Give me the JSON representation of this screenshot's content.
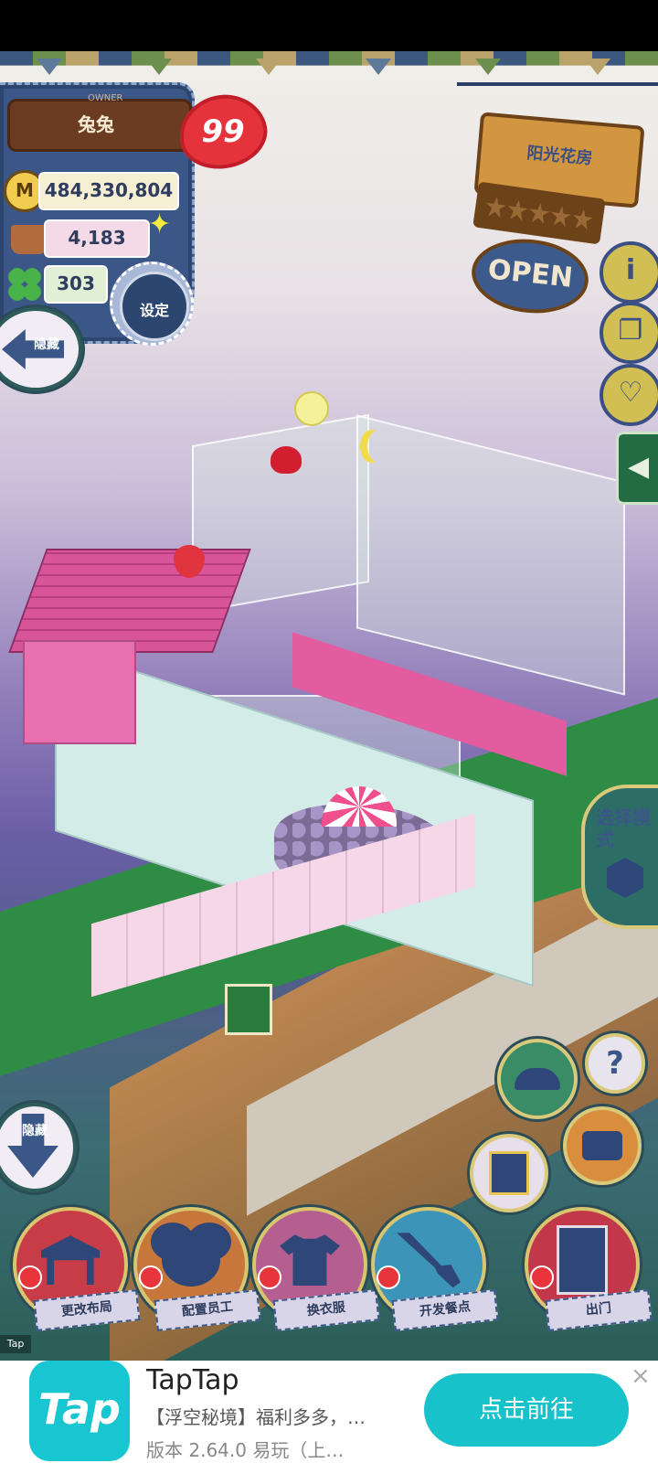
{
  "owner": {
    "label": "OWNER",
    "name": "兔兔",
    "level": "99"
  },
  "stats": {
    "money": "484,330,804",
    "money_icon_letter": "M",
    "customers": "4,183",
    "clovers": "303"
  },
  "buttons": {
    "settings": "设定",
    "hide_top": "隐藏",
    "hide_bottom": "隐藏",
    "select_mode": "选择模式",
    "help": "?"
  },
  "shop": {
    "name": "阳光花房",
    "rating_stars": 0,
    "max_stars": 5,
    "status": "OPEN"
  },
  "side_icons": [
    "info-icon",
    "book-icon",
    "heart-bubble-icon"
  ],
  "bottom_actions": [
    {
      "label": "更改布局",
      "icon": "table-icon",
      "color": "#c73c47"
    },
    {
      "label": "配置员工",
      "icon": "bear-icon",
      "color": "#c7773c"
    },
    {
      "label": "换衣服",
      "icon": "shirt-icon",
      "color": "#b45f8f"
    },
    {
      "label": "开发餐点",
      "icon": "knife-icon",
      "color": "#3c95b9"
    },
    {
      "label": "出门",
      "icon": "door-icon",
      "color": "#c2384a"
    }
  ],
  "ad": {
    "tag": "Tap",
    "logo_text": "Tap",
    "title": "TapTap",
    "description": "【浮空秘境】福利多多，…",
    "version": "版本 2.64.0  易玩（上…",
    "cta": "点击前往",
    "close": "×"
  },
  "colors": {
    "panel": "#3b5788",
    "accent_gold": "#d9c97a",
    "heart": "#e5333b",
    "cta": "#17c2cb"
  }
}
